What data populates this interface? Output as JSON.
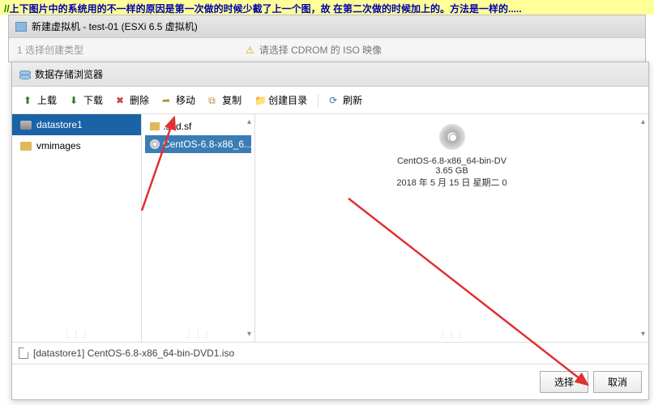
{
  "annotation": {
    "comment_mark": "//",
    "text": "上下图片中的系统用的不一样的原因是第一次做的时候少截了上一个图，故 在第二次做的时候加上的。方法是一样的....."
  },
  "outer_window": {
    "title": "新建虚拟机 - test-01 (ESXi 6.5 虚拟机)",
    "step_label": "1 选择创建类型",
    "warning": "请选择 CDROM 的 ISO 映像"
  },
  "dialog": {
    "title": "数据存储浏览器",
    "toolbar": {
      "upload": "上载",
      "download": "下载",
      "delete": "删除",
      "move": "移动",
      "copy": "复制",
      "newdir": "创建目录",
      "refresh": "刷新"
    },
    "tree": {
      "items": [
        {
          "label": "datastore1",
          "type": "ds",
          "selected": true
        },
        {
          "label": "vmimages",
          "type": "folder",
          "selected": false
        }
      ]
    },
    "list": {
      "items": [
        {
          "label": ".sdd.sf",
          "type": "folder",
          "selected": false
        },
        {
          "label": "CentOS-6.8-x86_6...",
          "type": "disc",
          "selected": true
        }
      ]
    },
    "detail": {
      "filename": "CentOS-6.8-x86_64-bin-DV",
      "size": "3.65 GB",
      "date": "2018 年 5 月 15 日 星期二 0"
    },
    "status": "[datastore1] CentOS-6.8-x86_64-bin-DVD1.iso",
    "buttons": {
      "select": "选择",
      "cancel": "取消"
    }
  }
}
